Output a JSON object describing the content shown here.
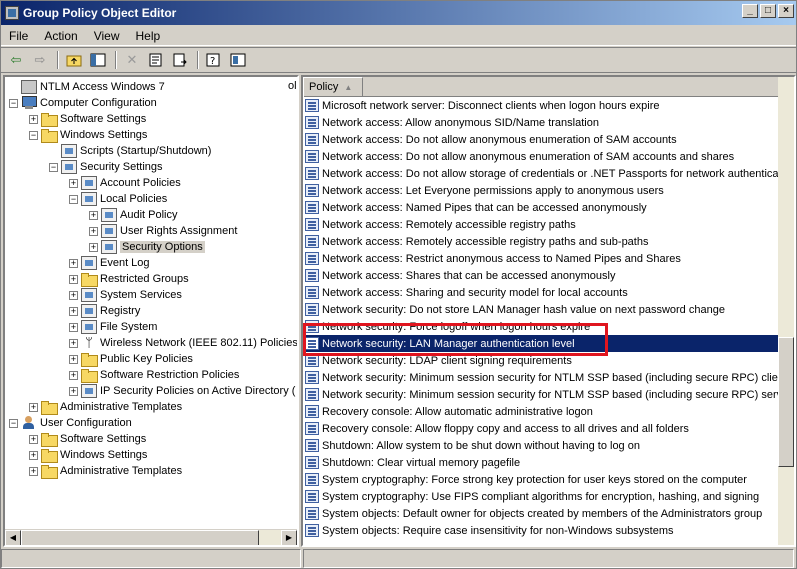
{
  "window": {
    "title": "Group Policy Object Editor",
    "buttons": {
      "minimize": "_",
      "maximize": "□",
      "close": "×"
    }
  },
  "menu": [
    {
      "label": "File"
    },
    {
      "label": "Action"
    },
    {
      "label": "View"
    },
    {
      "label": "Help"
    }
  ],
  "toolbar": {
    "icons": [
      "back-arrow-icon",
      "forward-arrow-icon",
      "up-folder-icon",
      "show-hide-tree-icon",
      "delete-icon",
      "properties-icon",
      "export-list-icon",
      "help-icon",
      "console-icon"
    ]
  },
  "tree": {
    "items": [
      {
        "label": "NTLM Access Windows 7",
        "icon": "root",
        "level": 0,
        "expander": ""
      },
      {
        "label": "Computer Configuration",
        "icon": "computer",
        "level": 0,
        "expander": "−"
      },
      {
        "label": "Software Settings",
        "icon": "folder",
        "level": 1,
        "expander": "+"
      },
      {
        "label": "Windows Settings",
        "icon": "folder",
        "level": 1,
        "expander": "−"
      },
      {
        "label": "Scripts (Startup/Shutdown)",
        "icon": "policy",
        "level": 2,
        "expander": ""
      },
      {
        "label": "Security Settings",
        "icon": "policy",
        "level": 2,
        "expander": "−"
      },
      {
        "label": "Account Policies",
        "icon": "policy",
        "level": 3,
        "expander": "+"
      },
      {
        "label": "Local Policies",
        "icon": "policy",
        "level": 3,
        "expander": "−"
      },
      {
        "label": "Audit Policy",
        "icon": "policy",
        "level": 4,
        "expander": "+"
      },
      {
        "label": "User Rights Assignment",
        "icon": "policy",
        "level": 4,
        "expander": "+"
      },
      {
        "label": "Security Options",
        "icon": "policy",
        "level": 4,
        "expander": "+",
        "selected": true
      },
      {
        "label": "Event Log",
        "icon": "policy",
        "level": 3,
        "expander": "+"
      },
      {
        "label": "Restricted Groups",
        "icon": "folder",
        "level": 3,
        "expander": "+"
      },
      {
        "label": "System Services",
        "icon": "policy",
        "level": 3,
        "expander": "+"
      },
      {
        "label": "Registry",
        "icon": "policy",
        "level": 3,
        "expander": "+"
      },
      {
        "label": "File System",
        "icon": "policy",
        "level": 3,
        "expander": "+"
      },
      {
        "label": "Wireless Network (IEEE 802.11) Policies",
        "icon": "antenna",
        "level": 3,
        "expander": "+"
      },
      {
        "label": "Public Key Policies",
        "icon": "folder",
        "level": 3,
        "expander": "+"
      },
      {
        "label": "Software Restriction Policies",
        "icon": "folder",
        "level": 3,
        "expander": "+"
      },
      {
        "label": "IP Security Policies on Active Directory (",
        "icon": "policy",
        "level": 3,
        "expander": "+"
      },
      {
        "label": "Administrative Templates",
        "icon": "folder",
        "level": 1,
        "expander": "+"
      },
      {
        "label": "User Configuration",
        "icon": "user",
        "level": 0,
        "expander": "−"
      },
      {
        "label": "Software Settings",
        "icon": "folder",
        "level": 1,
        "expander": "+"
      },
      {
        "label": "Windows Settings",
        "icon": "folder",
        "level": 1,
        "expander": "+"
      },
      {
        "label": "Administrative Templates",
        "icon": "folder",
        "level": 1,
        "expander": "+"
      }
    ],
    "truncated_marker": "ol"
  },
  "list": {
    "column_header": "Policy",
    "sort_indicator": "▲",
    "rows": [
      "Microsoft network server: Disconnect clients when logon hours expire",
      "Network access: Allow anonymous SID/Name translation",
      "Network access: Do not allow anonymous enumeration of SAM accounts",
      "Network access: Do not allow anonymous enumeration of SAM accounts and shares",
      "Network access: Do not allow storage of credentials or .NET Passports for network authenticat",
      "Network access: Let Everyone permissions apply to anonymous users",
      "Network access: Named Pipes that can be accessed anonymously",
      "Network access: Remotely accessible registry paths",
      "Network access: Remotely accessible registry paths and sub-paths",
      "Network access: Restrict anonymous access to Named Pipes and Shares",
      "Network access: Shares that can be accessed anonymously",
      "Network access: Sharing and security model for local accounts",
      "Network security: Do not store LAN Manager hash value on next password change",
      "Network security: Force logoff when logon hours expire",
      "Network security: LAN Manager authentication level",
      "Network security: LDAP client signing requirements",
      "Network security: Minimum session security for NTLM SSP based (including secure RPC) clients",
      "Network security: Minimum session security for NTLM SSP based (including secure RPC) servers",
      "Recovery console: Allow automatic administrative logon",
      "Recovery console: Allow floppy copy and access to all drives and all folders",
      "Shutdown: Allow system to be shut down without having to log on",
      "Shutdown: Clear virtual memory pagefile",
      "System cryptography: Force strong key protection for user keys stored on the computer",
      "System cryptography: Use FIPS compliant algorithms for encryption, hashing, and signing",
      "System objects: Default owner for objects created by members of the Administrators group",
      "System objects: Require case insensitivity for non-Windows subsystems"
    ],
    "selected_index": 14
  },
  "colors": {
    "selection": "#0a246a",
    "highlight_box": "#e0151f"
  }
}
